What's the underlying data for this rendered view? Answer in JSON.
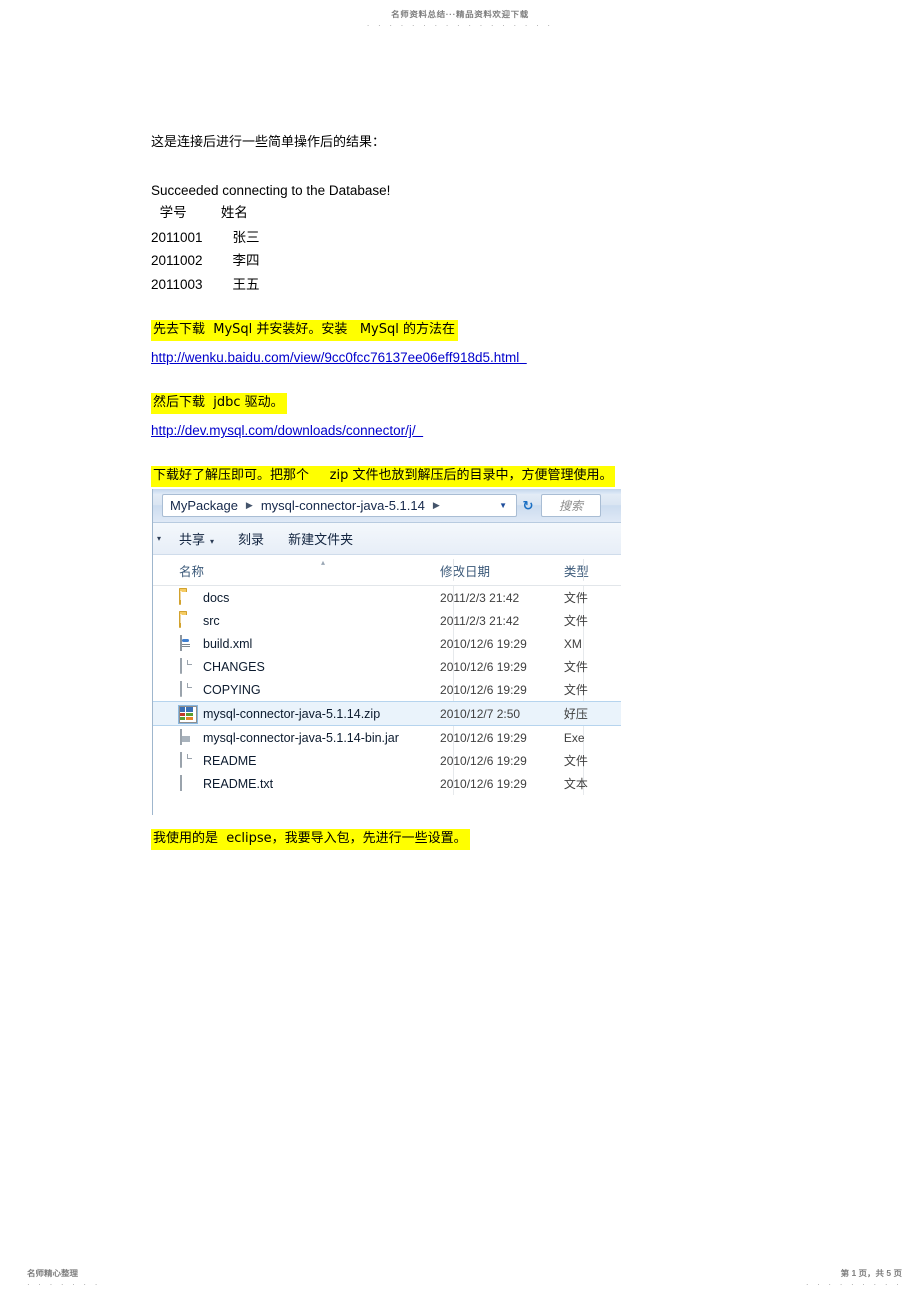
{
  "page": {
    "watermark_header": "名师资料总结···精品资料欢迎下载",
    "watermark_dots": "· · · · · · · · · · · · · · · · ·",
    "footer_left": "名师精心整理",
    "footer_left_dots": "· · · · · · ·",
    "footer_right": "第 1 页，共 5 页",
    "footer_right_dots": "· · · · · · · · ·"
  },
  "doc": {
    "intro_line": "这是连接后进行一些简单操作后的结果：",
    "console_output": "Succeeded connecting to the Database!",
    "table_header": "  学号        姓名",
    "rows": [
      "2011001        张三",
      "2011002        李四",
      "2011003        王五"
    ],
    "highlight1": "先去下载  MySql 并安装好。安装   MySql 的方法在",
    "url1": "http://wenku.baidu.com/view/9cc0fcc76137ee06eff918d5.html  ",
    "highlight2": "然后下载  jdbc 驱动。",
    "url2": "http://dev.mysql.com/downloads/connector/j/  ",
    "highlight3": "下载好了解压即可。把那个     zip 文件也放到解压后的目录中，方便管理使用。",
    "highlight4": "我使用的是  eclipse，我要导入包，先进行一些设置。",
    "highlight_color": "#ffff00",
    "link_color": "#0000cc"
  },
  "explorer": {
    "breadcrumb": [
      {
        "label": "MyPackage",
        "sep": "▶"
      },
      {
        "label": "mysql-connector-java-5.1.14",
        "sep": "▶"
      }
    ],
    "breadcrumb_dropdown_icon": "chevron-down-icon",
    "refresh_icon": "refresh-icon",
    "search_placeholder": "搜索",
    "toolbar": {
      "overflow_caret": "▾",
      "items": [
        {
          "label": "共享",
          "caret": "▾"
        },
        {
          "label": "刻录",
          "caret": ""
        },
        {
          "label": "新建文件夹",
          "caret": ""
        }
      ]
    },
    "columns": [
      {
        "label": "名称",
        "sorted": true,
        "sort_mark": "▴"
      },
      {
        "label": "修改日期",
        "sorted": false,
        "sort_mark": ""
      },
      {
        "label": "类型",
        "sorted": false,
        "sort_mark": ""
      }
    ],
    "files": [
      {
        "name": "docs",
        "date": "2011/2/3 21:42",
        "type": "文件",
        "icon": "folder-icon",
        "selected": false
      },
      {
        "name": "src",
        "date": "2011/2/3 21:42",
        "type": "文件",
        "icon": "folder-icon",
        "selected": false
      },
      {
        "name": "build.xml",
        "date": "2010/12/6 19:29",
        "type": "XM",
        "icon": "xml-file-icon",
        "selected": false
      },
      {
        "name": "CHANGES",
        "date": "2010/12/6 19:29",
        "type": "文件",
        "icon": "blank-file-icon",
        "selected": false
      },
      {
        "name": "COPYING",
        "date": "2010/12/6 19:29",
        "type": "文件",
        "icon": "blank-file-icon",
        "selected": false
      },
      {
        "name": "mysql-connector-java-5.1.14.zip",
        "date": "2010/12/7 2:50",
        "type": "好压",
        "icon": "zip-archive-icon",
        "selected": true
      },
      {
        "name": "mysql-connector-java-5.1.14-bin.jar",
        "date": "2010/12/6 19:29",
        "type": "Exe",
        "icon": "jar-file-icon",
        "selected": false
      },
      {
        "name": "README",
        "date": "2010/12/6 19:29",
        "type": "文件",
        "icon": "blank-file-icon",
        "selected": false
      },
      {
        "name": "README.txt",
        "date": "2010/12/6 19:29",
        "type": "文本",
        "icon": "text-file-icon",
        "selected": false
      }
    ]
  }
}
